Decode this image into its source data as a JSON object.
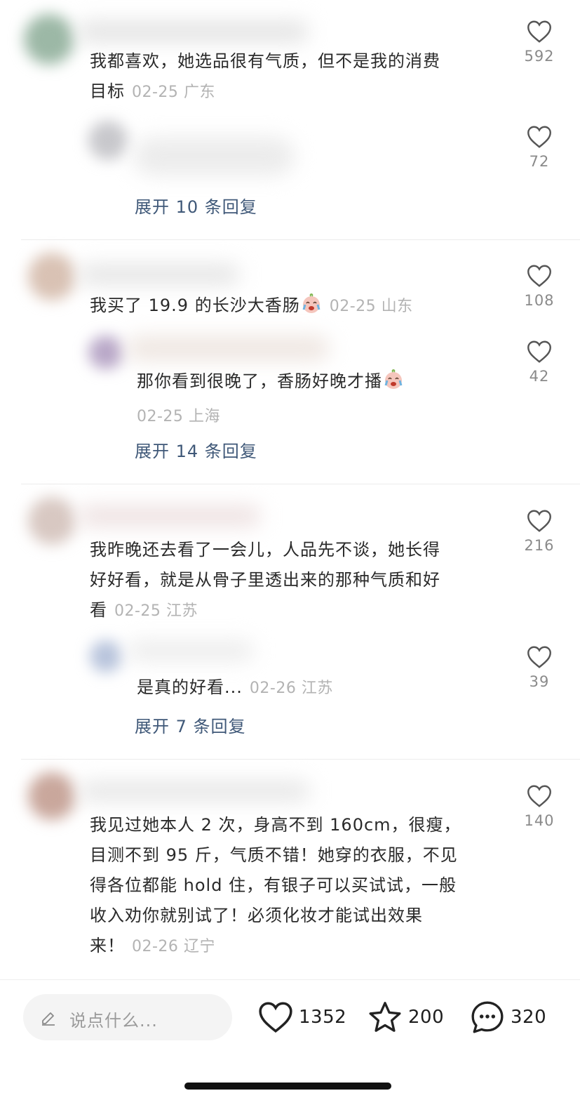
{
  "comments": [
    {
      "text": "我都喜欢，她选品很有气质，但不是我的消费",
      "text2": "目标",
      "date": "02-25",
      "location": "广东",
      "likes": "592",
      "reply": {
        "likes": "72"
      },
      "expand": "展开 10 条回复"
    },
    {
      "text": "我买了 19.9 的长沙大香肠",
      "date": "02-25",
      "location": "山东",
      "likes": "108",
      "reply": {
        "text": "那你看到很晚了，香肠好晚才播",
        "date": "02-25",
        "location": "上海",
        "likes": "42"
      },
      "expand": "展开 14 条回复"
    },
    {
      "text": "我昨晚还去看了一会儿，人品先不谈，她长得",
      "text2": "好好看，就是从骨子里透出来的那种气质和好",
      "text3": "看",
      "date": "02-25",
      "location": "江苏",
      "likes": "216",
      "reply": {
        "text": "是真的好看...",
        "date": "02-26",
        "location": "江苏",
        "likes": "39"
      },
      "expand": "展开 7 条回复"
    },
    {
      "text": "我见过她本人 2 次，身高不到 160cm，很瘦，",
      "text2": "目测不到 95 斤，气质不错！她穿的衣服，不见",
      "text3": "得各位都能 hold 住，有银子可以买试试，一般",
      "text4": "收入劝你就别试了！必须化妆才能试出效果",
      "text5": "来！",
      "date": "02-26",
      "location": "辽宁",
      "likes": "140"
    }
  ],
  "bottom_bar": {
    "input_placeholder": "说点什么...",
    "likes": "1352",
    "favorites": "200",
    "comments": "320"
  },
  "icons": [
    "heart-icon",
    "pencil-icon",
    "star-icon",
    "chat-bubble-icon",
    "crying-laugh-emoji"
  ]
}
